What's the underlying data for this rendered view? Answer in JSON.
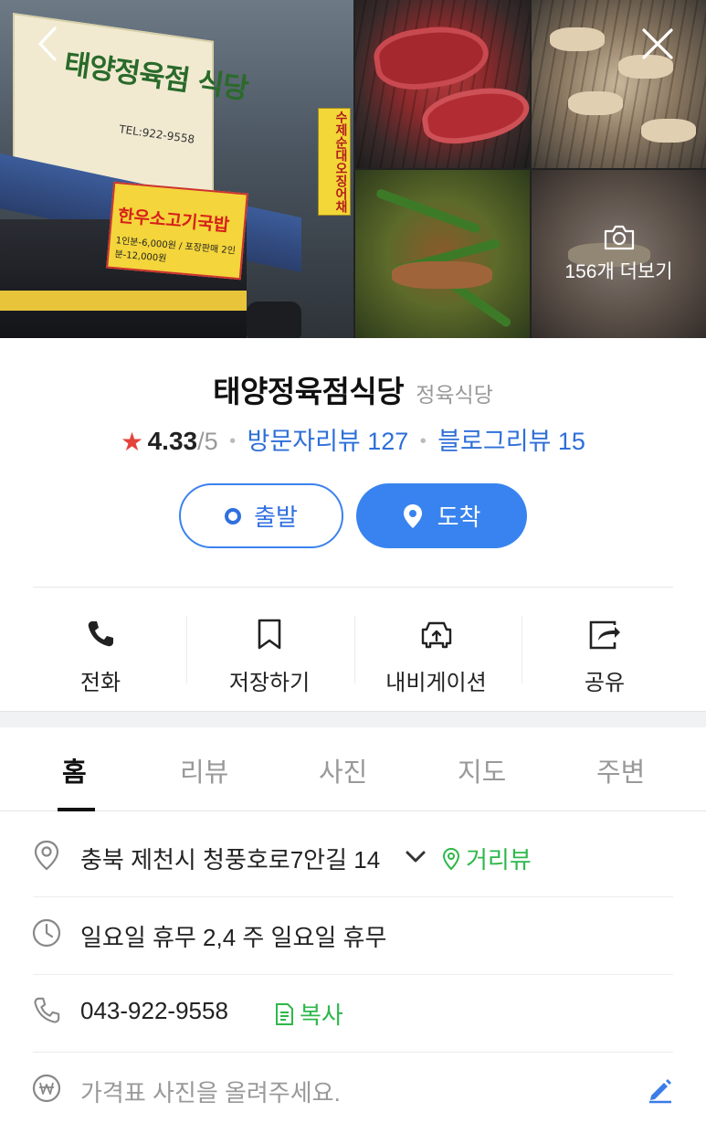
{
  "photos": {
    "storefront_sign": "태양정육점 식당",
    "storefront_tel": "TEL:922-9558",
    "banner_main": "한우소고기국밥",
    "banner_sub": "1인분-6,000원 / 포장판매 2인분-12,000원",
    "side_sign": "수제순대오징어채",
    "more_label": "156개 더보기"
  },
  "place": {
    "name": "태양정육점식당",
    "category": "정육식당"
  },
  "rating": {
    "star": "★",
    "score": "4.33",
    "out_of": "/5",
    "visitor_reviews": "방문자리뷰 127",
    "blog_reviews": "블로그리뷰 15"
  },
  "route": {
    "start_label": "출발",
    "end_label": "도착"
  },
  "actions": [
    {
      "label": "전화",
      "icon": "phone-icon"
    },
    {
      "label": "저장하기",
      "icon": "bookmark-icon"
    },
    {
      "label": "내비게이션",
      "icon": "car-navigation-icon"
    },
    {
      "label": "공유",
      "icon": "share-icon"
    }
  ],
  "tabs": [
    {
      "label": "홈",
      "active": true
    },
    {
      "label": "리뷰",
      "active": false
    },
    {
      "label": "사진",
      "active": false
    },
    {
      "label": "지도",
      "active": false
    },
    {
      "label": "주변",
      "active": false
    }
  ],
  "info": {
    "address": "충북 제천시 청풍호로7안길 14",
    "street_view": "거리뷰",
    "hours": "일요일 휴무 2,4 주 일요일 휴무",
    "phone": "043-922-9558",
    "copy": "복사",
    "price_placeholder": "가격표 사진을 올려주세요."
  },
  "colors": {
    "accent_blue": "#3883ef",
    "star_red": "#e5433a",
    "link_blue": "#2e6fd8",
    "green": "#2db84a"
  }
}
